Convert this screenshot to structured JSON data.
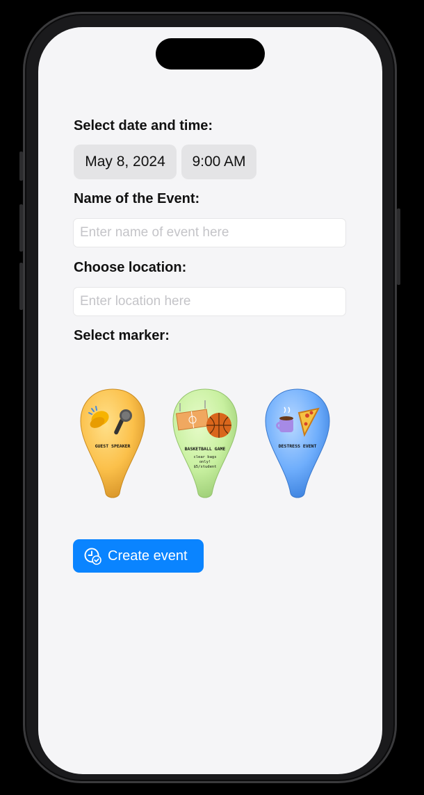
{
  "form": {
    "date_time_label": "Select date and time:",
    "date_value": "May 8, 2024",
    "time_value": "9:00 AM",
    "event_name_label": "Name of the Event:",
    "event_name_placeholder": "Enter name of event here",
    "location_label": "Choose location:",
    "location_placeholder": "Enter location here",
    "marker_label": "Select marker:",
    "create_button_label": "Create event",
    "create_button_icon": "clock-checkmark-icon"
  },
  "markers": [
    {
      "label": "GUEST SPEAKER",
      "color": "#fbc04a",
      "icons": [
        "clapping-hands-icon",
        "microphone-icon"
      ]
    },
    {
      "label": "BASKETBALL GAME",
      "note_lines": [
        "clear bags",
        "only!",
        "$5/student"
      ],
      "color": "#c8f0a0",
      "icons": [
        "basketball-court-icon",
        "basketball-icon"
      ]
    },
    {
      "label": "DESTRESS EVENT",
      "color": "#6faefc",
      "icons": [
        "mug-icon",
        "pizza-icon"
      ]
    }
  ],
  "colors": {
    "accent": "#0a84ff",
    "background": "#f5f5f7"
  }
}
